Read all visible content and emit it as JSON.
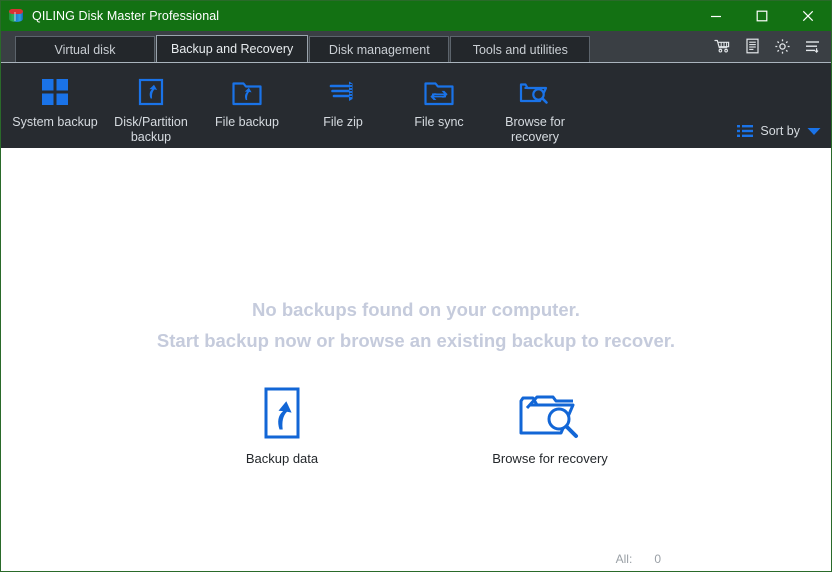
{
  "window": {
    "title": "QILING Disk Master Professional",
    "app_icon": "disk-cylinder-icon",
    "accent_green": "#137113",
    "border_green": "#2a6a2a",
    "accent_blue": "#1a73e8",
    "controls": {
      "minimize": "minimize-icon",
      "maximize": "maximize-icon",
      "close": "close-icon"
    }
  },
  "tabs": [
    {
      "label": "Virtual disk",
      "active": false
    },
    {
      "label": "Backup and Recovery",
      "active": true
    },
    {
      "label": "Disk management",
      "active": false
    },
    {
      "label": "Tools and utilities",
      "active": false
    }
  ],
  "tabbar_icons": [
    {
      "name": "shopping-cart-icon",
      "title": "Buy now"
    },
    {
      "name": "log-document-icon",
      "title": "Logs"
    },
    {
      "name": "gear-icon",
      "title": "Settings"
    },
    {
      "name": "menu-list-icon",
      "title": "Menu"
    }
  ],
  "toolbar": {
    "items": [
      {
        "label": "System backup",
        "icon": "windows-squares-icon"
      },
      {
        "label": "Disk/Partition\nbackup",
        "icon": "disk-arrow-icon"
      },
      {
        "label": "File backup",
        "icon": "folder-arrow-icon"
      },
      {
        "label": "File zip",
        "icon": "zip-stack-icon"
      },
      {
        "label": "File sync",
        "icon": "folder-sync-icon"
      },
      {
        "label": "Browse for\nrecovery",
        "icon": "folder-search-icon"
      }
    ],
    "sort": {
      "label": "Sort by",
      "list_icon": "sort-list-icon",
      "chevron_icon": "chevron-down-icon"
    }
  },
  "content": {
    "empty_line1": "No backups found on your computer.",
    "empty_line2": "Start backup now or browse an existing backup to recover.",
    "actions": [
      {
        "label": "Backup data",
        "icon": "document-up-arrow-icon"
      },
      {
        "label": "Browse for recovery",
        "icon": "folder-search-large-icon"
      }
    ]
  },
  "statusbar": {
    "all_label": "All:",
    "all_count": "0"
  }
}
